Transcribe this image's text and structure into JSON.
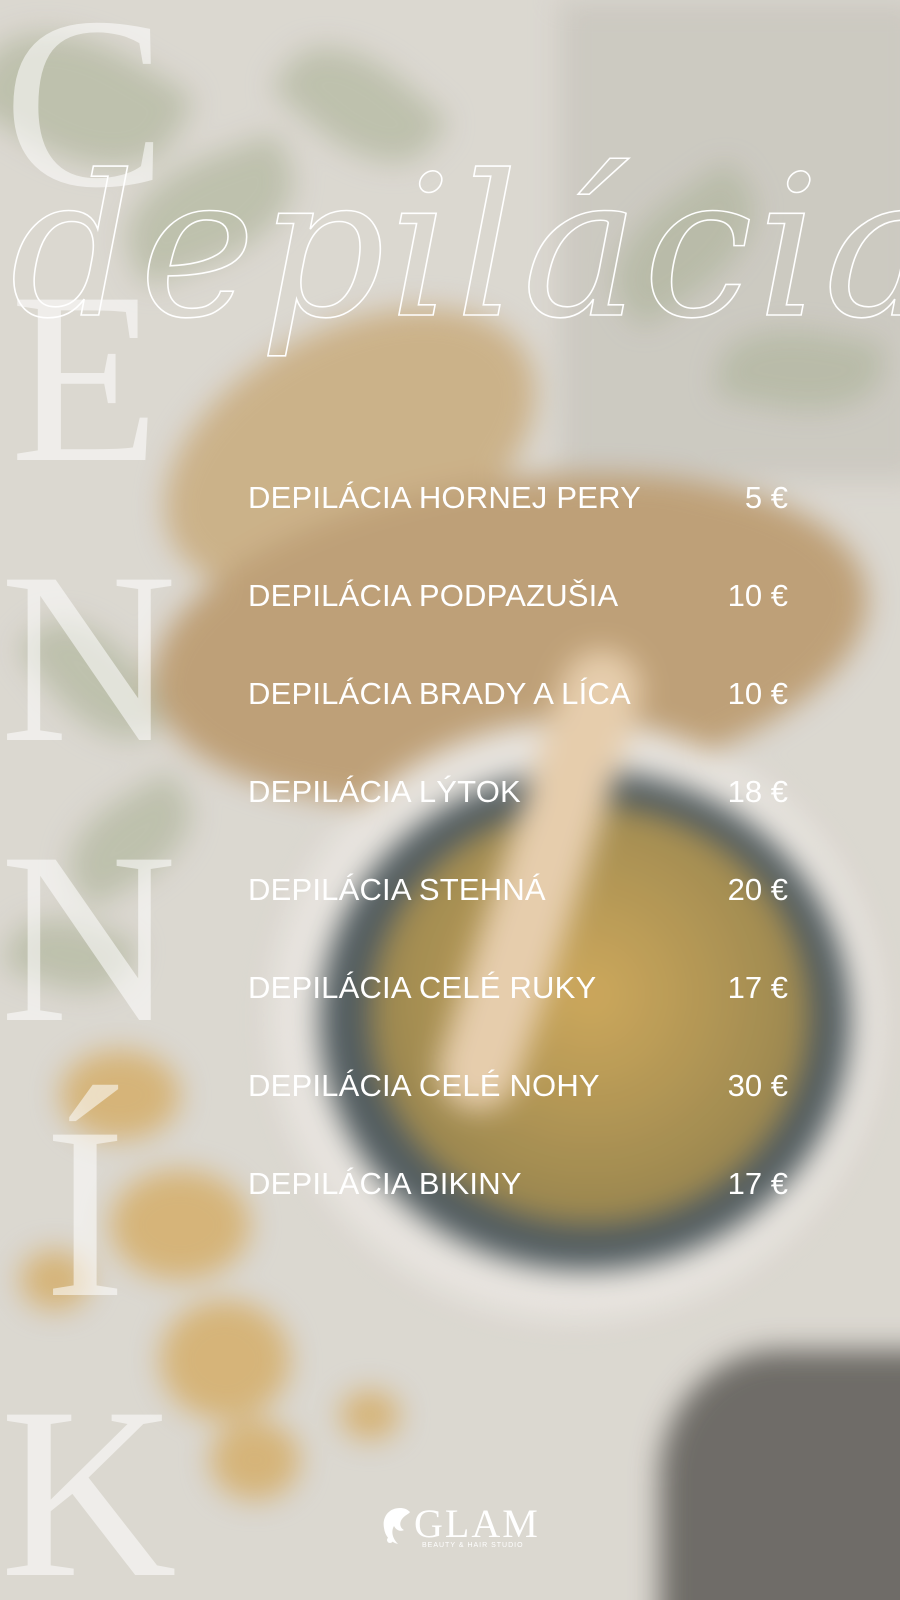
{
  "vertical_title": {
    "letters": [
      "C",
      "E",
      "N",
      "N",
      "Í",
      "K"
    ]
  },
  "heading": "depilácia",
  "price_list": [
    {
      "service": "DEPILÁCIA HORNEJ PERY",
      "price": "5 €"
    },
    {
      "service": "DEPILÁCIA PODPAZUŠIA",
      "price": "10 €"
    },
    {
      "service": "DEPILÁCIA BRADY A LÍCA",
      "price": "10 €"
    },
    {
      "service": "DEPILÁCIA LÝTOK",
      "price": "18 €"
    },
    {
      "service": "DEPILÁCIA STEHNÁ",
      "price": "20 €"
    },
    {
      "service": "DEPILÁCIA CELÉ RUKY",
      "price": "17 €"
    },
    {
      "service": "DEPILÁCIA CELÉ NOHY",
      "price": "30 €"
    },
    {
      "service": "DEPILÁCIA BIKINY",
      "price": "17 €"
    }
  ],
  "logo": {
    "name": "GLAM",
    "tagline": "BEAUTY & HAIR STUDIO",
    "icon": "woman-profile-icon"
  },
  "colors": {
    "text": "#ffffff",
    "background": "#d9d6cf"
  }
}
